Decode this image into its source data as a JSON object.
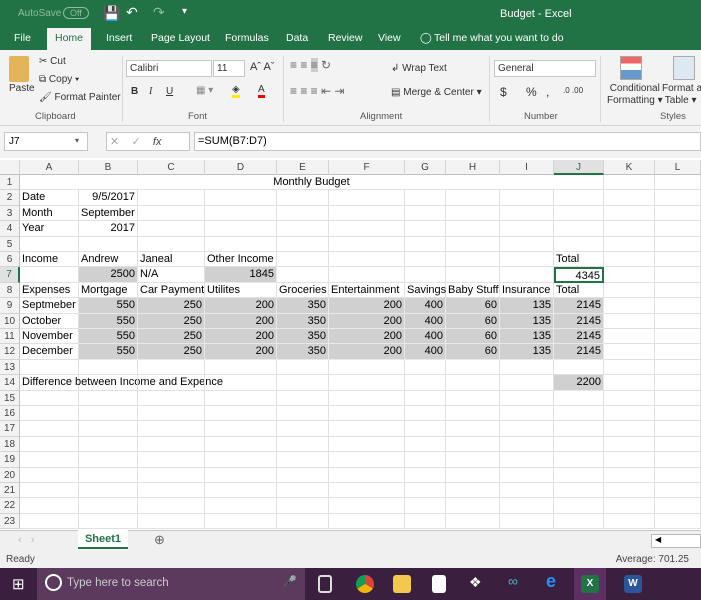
{
  "titlebar": {
    "autosave": "AutoSave",
    "autosave_state": "Off",
    "title": "Budget  -  Excel"
  },
  "tabs": [
    "File",
    "Home",
    "Insert",
    "Page Layout",
    "Formulas",
    "Data",
    "Review",
    "View"
  ],
  "tell_me": "Tell me what you want to do",
  "ribbon": {
    "clipboard": {
      "paste": "Paste",
      "cut": "Cut",
      "copy": "Copy",
      "format_painter": "Format Painter",
      "label": "Clipboard"
    },
    "font": {
      "name": "Calibri",
      "size": "11",
      "bold": "B",
      "italic": "I",
      "underline": "U",
      "label": "Font"
    },
    "alignment": {
      "wrap": "Wrap Text",
      "merge": "Merge & Center",
      "label": "Alignment"
    },
    "number": {
      "format": "General",
      "currency": "$",
      "percent": "%",
      "comma": ",",
      "label": "Number"
    },
    "styles": {
      "conditional": "Conditional",
      "conditional2": "Formatting",
      "format_as": "Format as",
      "format_as2": "Table",
      "label": "Styles"
    }
  },
  "formula_bar": {
    "name_box": "J7",
    "formula": "=SUM(B7:D7)"
  },
  "columns": [
    "A",
    "B",
    "C",
    "D",
    "E",
    "F",
    "G",
    "H",
    "I",
    "J",
    "K",
    "L"
  ],
  "selected_col": "J",
  "selected_row": 7,
  "rows": [
    [
      "",
      "",
      "",
      "",
      "",
      "Monthly Budget",
      "",
      "",
      "",
      "",
      "",
      ""
    ],
    [
      "Date",
      "9/5/2017",
      "",
      "",
      "",
      "",
      "",
      "",
      "",
      "",
      "",
      ""
    ],
    [
      "Month",
      "September",
      "",
      "",
      "",
      "",
      "",
      "",
      "",
      "",
      "",
      ""
    ],
    [
      "Year",
      "2017",
      "",
      "",
      "",
      "",
      "",
      "",
      "",
      "",
      "",
      ""
    ],
    [
      "",
      "",
      "",
      "",
      "",
      "",
      "",
      "",
      "",
      "",
      "",
      ""
    ],
    [
      "Income",
      "Andrew",
      "Janeal",
      "Other Income",
      "",
      "",
      "",
      "",
      "",
      "Total",
      "",
      ""
    ],
    [
      "",
      "2500",
      "N/A",
      "1845",
      "",
      "",
      "",
      "",
      "",
      "4345",
      "",
      ""
    ],
    [
      "Expenses",
      "Mortgage",
      "Car Payment",
      "Utilites",
      "Groceries",
      "Entertainment",
      "Savings",
      "Baby Stuff",
      "Insurance",
      "Total",
      "",
      ""
    ],
    [
      "Septmeber",
      "550",
      "250",
      "200",
      "350",
      "200",
      "400",
      "60",
      "135",
      "2145",
      "",
      ""
    ],
    [
      "October",
      "550",
      "250",
      "200",
      "350",
      "200",
      "400",
      "60",
      "135",
      "2145",
      "",
      ""
    ],
    [
      "November",
      "550",
      "250",
      "200",
      "350",
      "200",
      "400",
      "60",
      "135",
      "2145",
      "",
      ""
    ],
    [
      "December",
      "550",
      "250",
      "200",
      "350",
      "200",
      "400",
      "60",
      "135",
      "2145",
      "",
      ""
    ],
    [
      "",
      "",
      "",
      "",
      "",
      "",
      "",
      "",
      "",
      "",
      "",
      ""
    ],
    [
      "Difference between Income and Expence",
      "",
      "",
      "",
      "",
      "",
      "",
      "",
      "",
      "2200",
      "",
      ""
    ],
    [
      "",
      "",
      "",
      "",
      "",
      "",
      "",
      "",
      "",
      "",
      "",
      ""
    ],
    [
      "",
      "",
      "",
      "",
      "",
      "",
      "",
      "",
      "",
      "",
      "",
      ""
    ],
    [
      "",
      "",
      "",
      "",
      "",
      "",
      "",
      "",
      "",
      "",
      "",
      ""
    ],
    [
      "",
      "",
      "",
      "",
      "",
      "",
      "",
      "",
      "",
      "",
      "",
      ""
    ],
    [
      "",
      "",
      "",
      "",
      "",
      "",
      "",
      "",
      "",
      "",
      "",
      ""
    ],
    [
      "",
      "",
      "",
      "",
      "",
      "",
      "",
      "",
      "",
      "",
      "",
      ""
    ],
    [
      "",
      "",
      "",
      "",
      "",
      "",
      "",
      "",
      "",
      "",
      "",
      ""
    ],
    [
      "",
      "",
      "",
      "",
      "",
      "",
      "",
      "",
      "",
      "",
      "",
      ""
    ],
    [
      "",
      "",
      "",
      "",
      "",
      "",
      "",
      "",
      "",
      "",
      "",
      ""
    ]
  ],
  "sheet_tab": "Sheet1",
  "status": {
    "left": "Ready",
    "right": "Average: 701.25"
  },
  "taskbar": {
    "search_placeholder": "Type here to search",
    "apps": [
      "task-view",
      "chrome",
      "file-explorer",
      "store",
      "dropbox",
      "arduino",
      "edge",
      "excel",
      "word"
    ]
  },
  "colors": {
    "accent": "#217346",
    "shade": "#d0d0d0",
    "taskbar": "#3a1f3e"
  }
}
